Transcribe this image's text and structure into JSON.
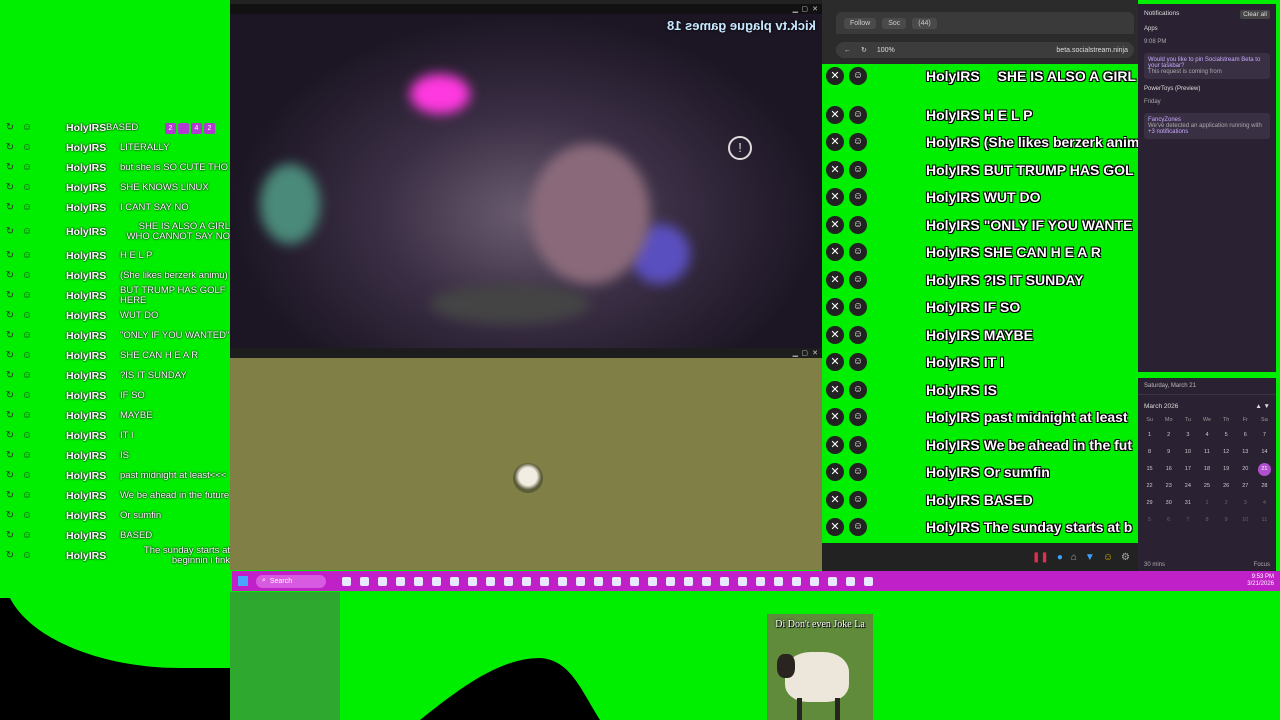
{
  "left_chat": {
    "rows": [
      {
        "user": "HolyIRS",
        "msg": "BASED"
      },
      {
        "user": "HolyIRS",
        "msg": "LITERALLY"
      },
      {
        "user": "HolyIRS",
        "msg": "but she is SO CUTE THO"
      },
      {
        "user": "HolyIRS",
        "msg": "SHE KNOWS LINUX"
      },
      {
        "user": "HolyIRS",
        "msg": "I CANT SAY NO"
      },
      {
        "user": "HolyIRS",
        "msg": "SHE IS ALSO A GIRL WHO CANNOT SAY NO"
      },
      {
        "user": "HolyIRS",
        "msg": "H E L P"
      },
      {
        "user": "HolyIRS",
        "msg": "(She likes berzerk animu)"
      },
      {
        "user": "HolyIRS",
        "msg": "BUT TRUMP HAS GOLF HERE"
      },
      {
        "user": "HolyIRS",
        "msg": "WUT DO"
      },
      {
        "user": "HolyIRS",
        "msg": "\"ONLY IF YOU WANTED\""
      },
      {
        "user": "HolyIRS",
        "msg": "SHE CAN H E A R"
      },
      {
        "user": "HolyIRS",
        "msg": "?IS IT SUNDAY"
      },
      {
        "user": "HolyIRS",
        "msg": "IF SO"
      },
      {
        "user": "HolyIRS",
        "msg": "MAYBE"
      },
      {
        "user": "HolyIRS",
        "msg": "IT I"
      },
      {
        "user": "HolyIRS",
        "msg": "IS"
      },
      {
        "user": "HolyIRS",
        "msg": "past midnight at least<<<"
      },
      {
        "user": "HolyIRS",
        "msg": "We be ahead in the future"
      },
      {
        "user": "HolyIRS",
        "msg": "Or sumfin"
      },
      {
        "user": "HolyIRS",
        "msg": "BASED"
      },
      {
        "user": "HolyIRS",
        "msg": "The sunday starts at beginnin i fink"
      }
    ],
    "badges": [
      "2",
      "",
      "4",
      "2"
    ]
  },
  "video": {
    "overlay_text": "kick.tv plague games 18"
  },
  "browser": {
    "tabs": [
      "Follow",
      "Soc",
      "(44)"
    ],
    "zoom": "100%",
    "url": "beta.socialstream.ninja"
  },
  "right_chat": {
    "header_partial": "SHE IS ALSO A GIRL",
    "lines": [
      {
        "user": "HolyIRS",
        "msg": "H E L P"
      },
      {
        "user": "HolyIRS",
        "msg": "(She likes berzerk anim"
      },
      {
        "user": "HolyIRS",
        "msg": "BUT TRUMP HAS GOL"
      },
      {
        "user": "HolyIRS",
        "msg": "WUT DO"
      },
      {
        "user": "HolyIRS",
        "msg": "\"ONLY IF YOU WANTE"
      },
      {
        "user": "HolyIRS",
        "msg": "SHE CAN H E A R"
      },
      {
        "user": "HolyIRS",
        "msg": "?IS IT SUNDAY"
      },
      {
        "user": "HolyIRS",
        "msg": "IF SO"
      },
      {
        "user": "HolyIRS",
        "msg": "MAYBE"
      },
      {
        "user": "HolyIRS",
        "msg": "IT I"
      },
      {
        "user": "HolyIRS",
        "msg": "IS"
      },
      {
        "user": "HolyIRS",
        "msg": "past midnight at least"
      },
      {
        "user": "HolyIRS",
        "msg": "We be ahead in the fut"
      },
      {
        "user": "HolyIRS",
        "msg": "Or sumfin"
      },
      {
        "user": "HolyIRS",
        "msg": "BASED"
      },
      {
        "user": "HolyIRS",
        "msg": "The sunday starts at b"
      }
    ]
  },
  "notifications": {
    "title": "Notifications",
    "clear_all": "Clear all",
    "apps_label": "Apps",
    "time": "9:08 PM",
    "pin_request": "Would you like to pin Socialstream Beta to your taskbar?",
    "pin_sub": "This request is coming from",
    "powertoys": "PowerToys (Preview)",
    "friday": "Friday",
    "fancyzones": "FancyZones",
    "fancyzones_msg": "We've detected an application running with",
    "more": "+3 notifications"
  },
  "calendar": {
    "date_header": "Saturday, March 21",
    "month": "March 2026",
    "dow": [
      "Su",
      "Mo",
      "Tu",
      "We",
      "Th",
      "Fr",
      "Sa"
    ],
    "days": [
      "1",
      "2",
      "3",
      "4",
      "5",
      "6",
      "7",
      "8",
      "9",
      "10",
      "11",
      "12",
      "13",
      "14",
      "15",
      "16",
      "17",
      "18",
      "19",
      "20",
      "21",
      "22",
      "23",
      "24",
      "25",
      "26",
      "27",
      "28",
      "29",
      "30",
      "31",
      "1",
      "2",
      "3",
      "4",
      "5",
      "6",
      "7",
      "8",
      "9",
      "10",
      "11"
    ],
    "today": "21",
    "timer": "30 mins",
    "focus": "Focus"
  },
  "taskbar": {
    "search": "Search",
    "time": "9:53 PM",
    "date": "3/21/2026"
  },
  "meme": {
    "caption": "Di Don't even Joke La"
  }
}
